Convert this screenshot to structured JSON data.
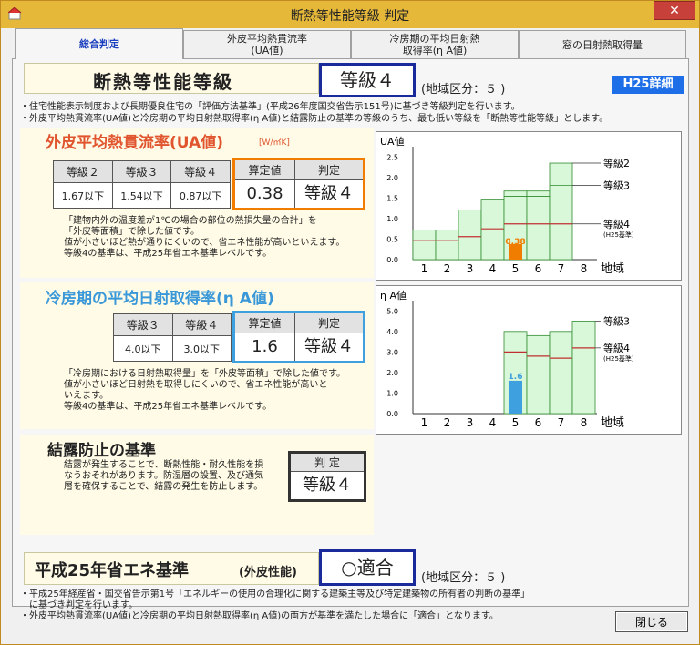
{
  "window": {
    "title": "断熱等性能等級 判定",
    "close_glyph": "✕"
  },
  "tabs": [
    {
      "label": "総合判定"
    },
    {
      "label": "外皮平均熱貫流率\n(UA値)"
    },
    {
      "label": "冷房期の平均日射熱\n取得率(η A値)"
    },
    {
      "label": "窓の日射熱取得量"
    }
  ],
  "grade": {
    "heading": "断熱等性能等級",
    "value": "等級４",
    "region": "(地域区分：５ )",
    "badge": "H25詳細",
    "notes": "・住宅性能表示制度および長期優良住宅の「評価方法基準」(平成26年度国交省告示151号)に基づき等級判定を行います。\n・外皮平均熱貫流率(UA値)と冷房期の平均日射熱取得率(η A値)と結露防止の基準の等級のうち、最も低い等級を「断熱等性能等級」とします。"
  },
  "ua": {
    "title": "外皮平均熱貫流率(UA値)",
    "unit": "[W/㎡K]",
    "headers": [
      "等級２",
      "等級３",
      "等級４",
      "算定値",
      "判定"
    ],
    "values": [
      "1.67以下",
      "1.54以下",
      "0.87以下"
    ],
    "calc": "0.38",
    "judge": "等級４",
    "desc": "「建物内外の温度差が1℃の場合の部位の熱損失量の合計」を\n「外皮等面積」で除した値です。\n値が小さいほど熱が通りにくいので、省エネ性能が高いといえます。\n等級4の基準は、平成25年省エネ基準レベルです。"
  },
  "eta": {
    "title": "冷房期の平均日射取得率(η A値)",
    "headers": [
      "等級３",
      "等級４",
      "算定値",
      "判定"
    ],
    "values": [
      "4.0以下",
      "3.0以下"
    ],
    "calc": "1.6",
    "judge": "等級４",
    "desc": "「冷房期における日射熱取得量」を「外皮等面積」で除した値です。\n値が小さいほど日射熱を取得しにくいので、省エネ性能が高いと\nいえます。\n等級4の基準は、平成25年省エネ基準レベルです。"
  },
  "condensation": {
    "title": "結露防止の基準",
    "judge_label": "判 定",
    "judge": "等級４",
    "desc": "結露が発生することで、断熱性能・耐久性能を損\nなうおそれがあります。防湿層の設置、及び通気\n層を確保することで、結露の発生を防止します。"
  },
  "h25": {
    "heading": "平成25年省エネ基準",
    "sub": "(外皮性能)",
    "result": "○適合",
    "region": "(地域区分：５ )",
    "notes": "・平成25年経産省・国交省告示第1号「エネルギーの使用の合理化に関する建築主等及び特定建築物の所有者の判断の基準」\n　に基づき判定を行います。\n・外皮平均熱貫流率(UA値)と冷房期の平均日射熱取得率(η A値)の両方が基準を満たした場合に「適合」となります。"
  },
  "close_button": "閉じる",
  "colors": {
    "accent_orange": "#f07d00",
    "accent_blue": "#3ea0de",
    "title_red": "#e0542e",
    "title_blue": "#3a98d8",
    "navy": "#1a2a9a",
    "bar_fill": "#d9f7d9",
    "bar_stroke": "#2e8b2e",
    "limit_line": "#c03030"
  },
  "chart_data": [
    {
      "type": "bar",
      "ylabel": "UA値",
      "xlabel": "地域",
      "categories": [
        "1",
        "2",
        "3",
        "4",
        "5",
        "6",
        "7",
        "8"
      ],
      "yticks": [
        "0.0",
        "0.5",
        "1.0",
        "1.5",
        "2.0",
        "2.5"
      ],
      "ylim": [
        0,
        2.75
      ],
      "series": [
        {
          "name": "等級2",
          "values": [
            0.72,
            0.72,
            1.21,
            1.47,
            1.67,
            1.67,
            2.35,
            null
          ]
        },
        {
          "name": "等級3",
          "values": [
            0.72,
            0.72,
            1.21,
            1.47,
            1.54,
            1.54,
            1.81,
            null
          ]
        },
        {
          "name": "等級4",
          "values": [
            0.46,
            0.46,
            0.56,
            0.75,
            0.87,
            0.87,
            0.87,
            null
          ]
        }
      ],
      "value": {
        "region": "5",
        "value": 0.38,
        "label": "0.38"
      },
      "legend": [
        "等級2",
        "等級3",
        "等級4",
        "(H25基準)"
      ]
    },
    {
      "type": "bar",
      "ylabel": "η A値",
      "xlabel": "地域",
      "categories": [
        "1",
        "2",
        "3",
        "4",
        "5",
        "6",
        "7",
        "8"
      ],
      "yticks": [
        "0.0",
        "1.0",
        "2.0",
        "3.0",
        "4.0",
        "5.0"
      ],
      "ylim": [
        0,
        5.5
      ],
      "series": [
        {
          "name": "等級3",
          "values": [
            null,
            null,
            null,
            null,
            4.0,
            3.8,
            4.0,
            4.5
          ]
        },
        {
          "name": "等級4",
          "values": [
            null,
            null,
            null,
            null,
            3.0,
            2.8,
            2.7,
            3.2
          ]
        }
      ],
      "value": {
        "region": "5",
        "value": 1.6,
        "label": "1.6"
      },
      "legend": [
        "等級3",
        "等級4",
        "(H25基準)"
      ]
    }
  ]
}
